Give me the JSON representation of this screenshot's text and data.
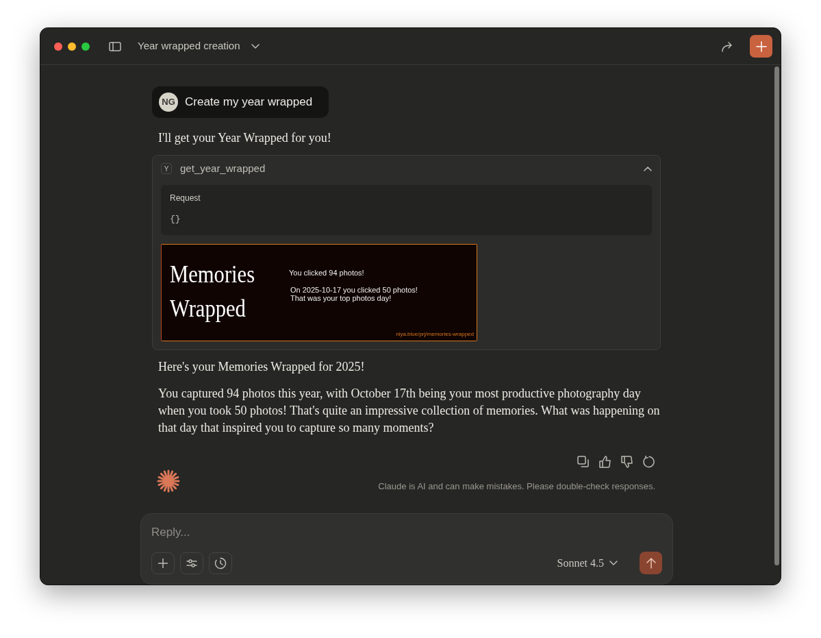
{
  "window": {
    "title": "Year wrapped creation"
  },
  "messages": [
    {
      "kind": "user",
      "avatar": "NG",
      "text": "Create my year wrapped"
    },
    {
      "kind": "assistant",
      "text": "I'll get your Year Wrapped for you!"
    },
    {
      "kind": "tool",
      "badge": "Y",
      "name": "get_year_wrapped",
      "expanded": true,
      "request_label": "Request",
      "request_body": "{}",
      "card": {
        "title_lines": [
          "Memories",
          "Wrapped"
        ],
        "stat": "You clicked 94 photos!",
        "detail_lines": [
          "On 2025-10-17 you clicked 50 photos!",
          "That was your top photos day!"
        ],
        "link": "niya.blue/prj/memories-wrapped"
      }
    },
    {
      "kind": "assistant",
      "text": "Here's your Memories Wrapped for 2025!"
    },
    {
      "kind": "assistant",
      "text": "You captured 94 photos this year, with October 17th being your most productive photography day when you took 50 photos! That's quite an impressive collection of memories. What was happening on that day that inspired you to capture so many moments?"
    }
  ],
  "disclaimer": "Claude is AI and can make mistakes. Please double-check responses.",
  "composer": {
    "placeholder": "Reply...",
    "model": "Sonnet 4.5"
  }
}
